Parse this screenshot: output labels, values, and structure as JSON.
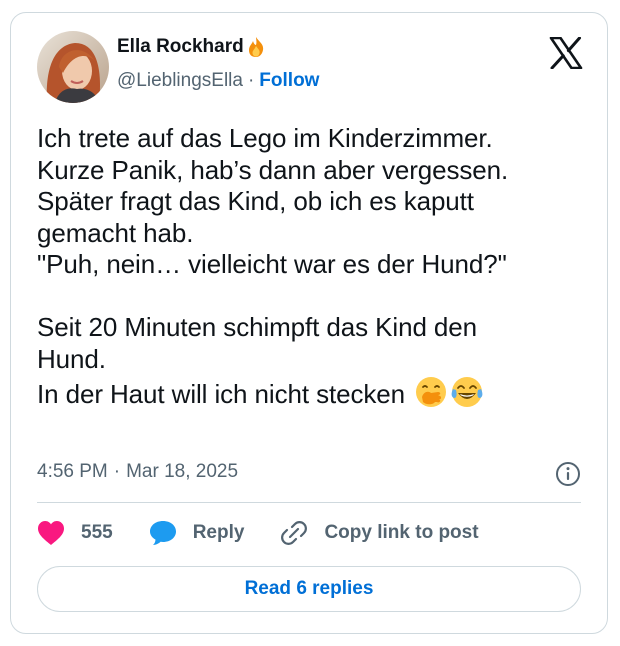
{
  "author": {
    "name": "Ella Rockhard",
    "name_icon": "fire-emoji",
    "handle": "@LieblingsElla",
    "separator": "·",
    "follow_label": "Follow",
    "avatar_icon": "profile-photo"
  },
  "brand_icon": "x-logo",
  "tweet": {
    "lines": [
      "Ich trete auf das Lego im Kinderzimmer.",
      "Kurze Panik, hab’s dann aber vergessen.",
      "Später fragt das Kind, ob ich es kaputt",
      "gemacht hab.",
      "\"Puh, nein… vielleicht war es der Hund?\"",
      "Seit 20 Minuten schimpft das Kind den",
      "Hund.",
      "In der Haut will ich nicht stecken"
    ],
    "trailing_emojis": [
      "hand-over-mouth-emoji",
      "tears-of-joy-emoji"
    ]
  },
  "meta": {
    "time": "4:56 PM",
    "separator": "·",
    "date": "Mar 18, 2025",
    "info_icon": "info-icon"
  },
  "actions": {
    "like_count": "555",
    "like_icon": "heart-icon",
    "reply_label": "Reply",
    "reply_icon": "speech-bubble-icon",
    "copy_label": "Copy link to post",
    "copy_icon": "link-icon"
  },
  "read_replies_label": "Read 6 replies",
  "colors": {
    "link_blue": "#006fd6",
    "heart_pink": "#f91880",
    "reply_blue": "#1d9bf0",
    "secondary_text": "#536471",
    "border": "#cfd9de"
  }
}
